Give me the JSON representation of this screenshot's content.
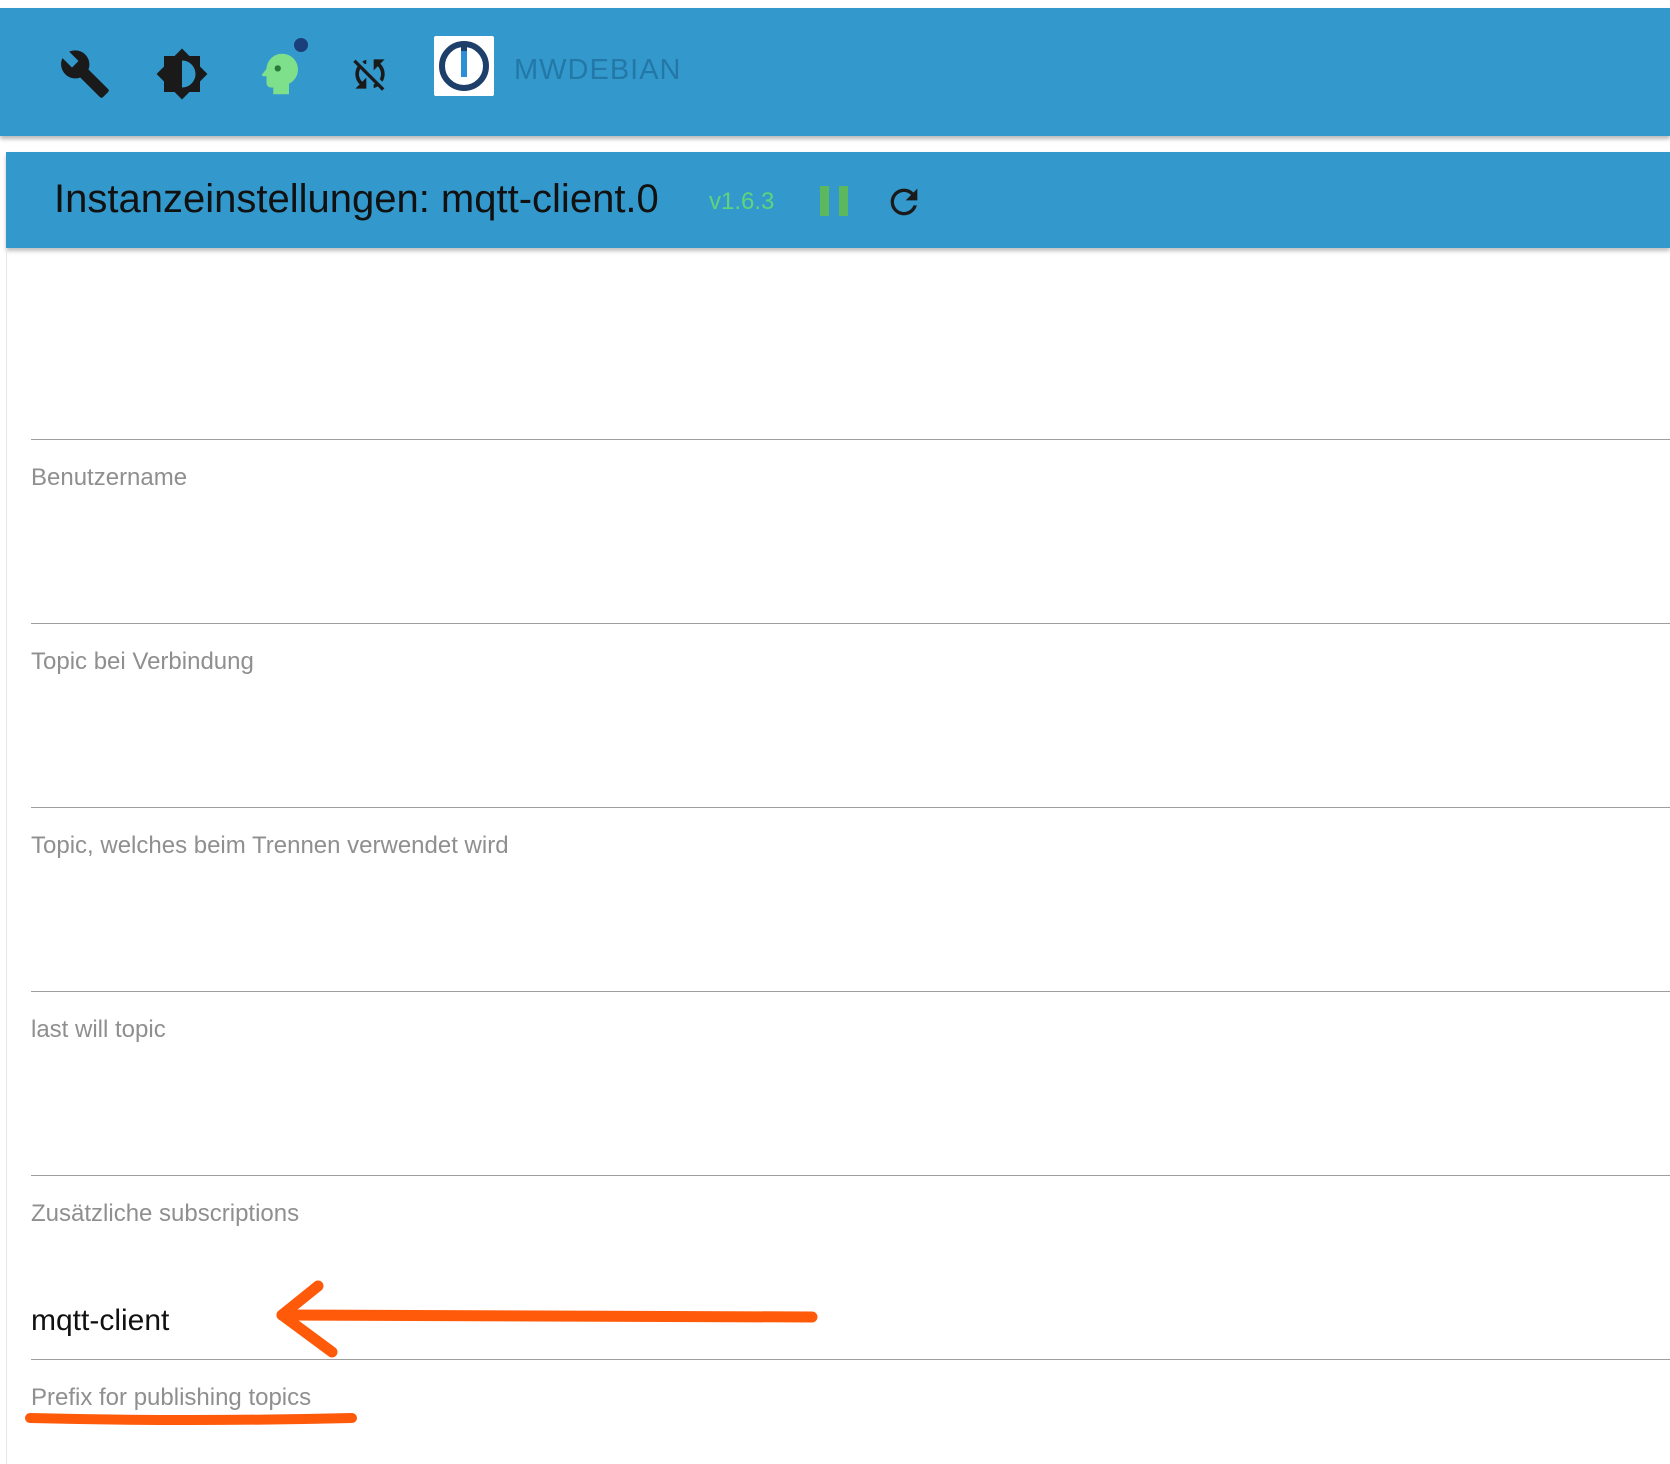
{
  "topbar": {
    "icons": [
      "wrench-icon",
      "brightness-icon",
      "head-icon",
      "sync-disabled-icon"
    ],
    "notification_dot_color": "#1a3f7a",
    "logo": "iobroker-logo-icon",
    "host_name": "MWDEBIAN"
  },
  "instance": {
    "title": "Instanzeinstellungen: mqtt-client.0",
    "version": "v1.6.3",
    "pause_icon": "pause-icon",
    "reload_icon": "reload-icon"
  },
  "fields": [
    {
      "label": "Benutzername",
      "value": ""
    },
    {
      "label": "Topic bei Verbindung",
      "value": ""
    },
    {
      "label": "Topic, welches beim Trennen verwendet wird",
      "value": ""
    },
    {
      "label": "last will topic",
      "value": ""
    },
    {
      "label": "Zusätzliche subscriptions",
      "value": ""
    },
    {
      "label": "Prefix for publishing topics",
      "value": "mqtt-client"
    }
  ],
  "annotation": {
    "color": "#ff5a0a",
    "arrow_target": "Prefix for publishing topics",
    "underline_target": "Prefix for publishing topics"
  },
  "colors": {
    "header_bg": "#3399cc",
    "version_green": "#5fd47a",
    "pause_green": "#5cb85c",
    "head_icon_green": "#7ee08a"
  }
}
